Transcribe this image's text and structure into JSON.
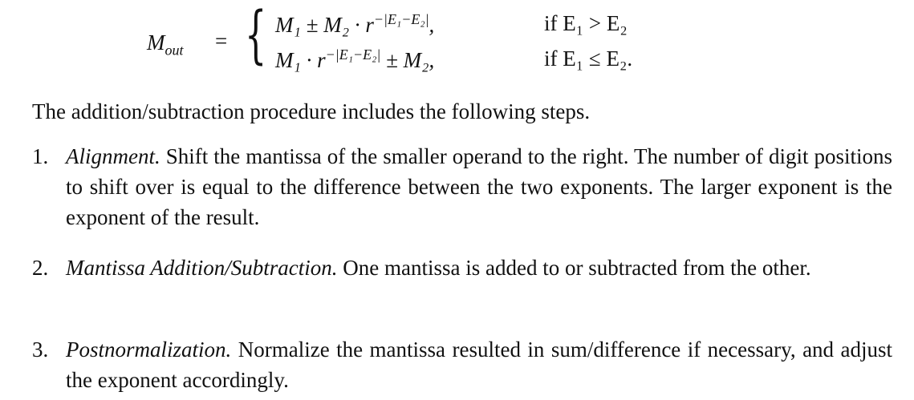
{
  "equation": {
    "lhs": "M",
    "lhs_sub": "out",
    "equals": "=",
    "brace": "{",
    "rows": [
      {
        "expr": "M₁ ± M₂ · r",
        "sup": "−|E₁−E₂|",
        "tail": ",",
        "condition": "if E₁ > E₂"
      },
      {
        "expr": "M₁ · r",
        "sup": "−|E₁−E₂|",
        "tail": " ± M₂,",
        "condition": "if E₁ ≤ E₂."
      }
    ]
  },
  "intro": "The addition/subtraction procedure includes the following steps.",
  "steps": [
    {
      "number": "1.",
      "title": "Alignment.",
      "text": " Shift the mantissa of the smaller operand to the right. The number of digit positions to shift over is equal to the difference between the two exponents. The larger exponent is the exponent of the result."
    },
    {
      "number": "2.",
      "title": "Mantissa Addition/Subtraction.",
      "text": " One mantissa is added to or subtracted from the other."
    },
    {
      "number": "3.",
      "title": "Postnormalization.",
      "text": " Normalize the mantissa resulted in sum/difference if necessary, and adjust the exponent accordingly."
    }
  ]
}
